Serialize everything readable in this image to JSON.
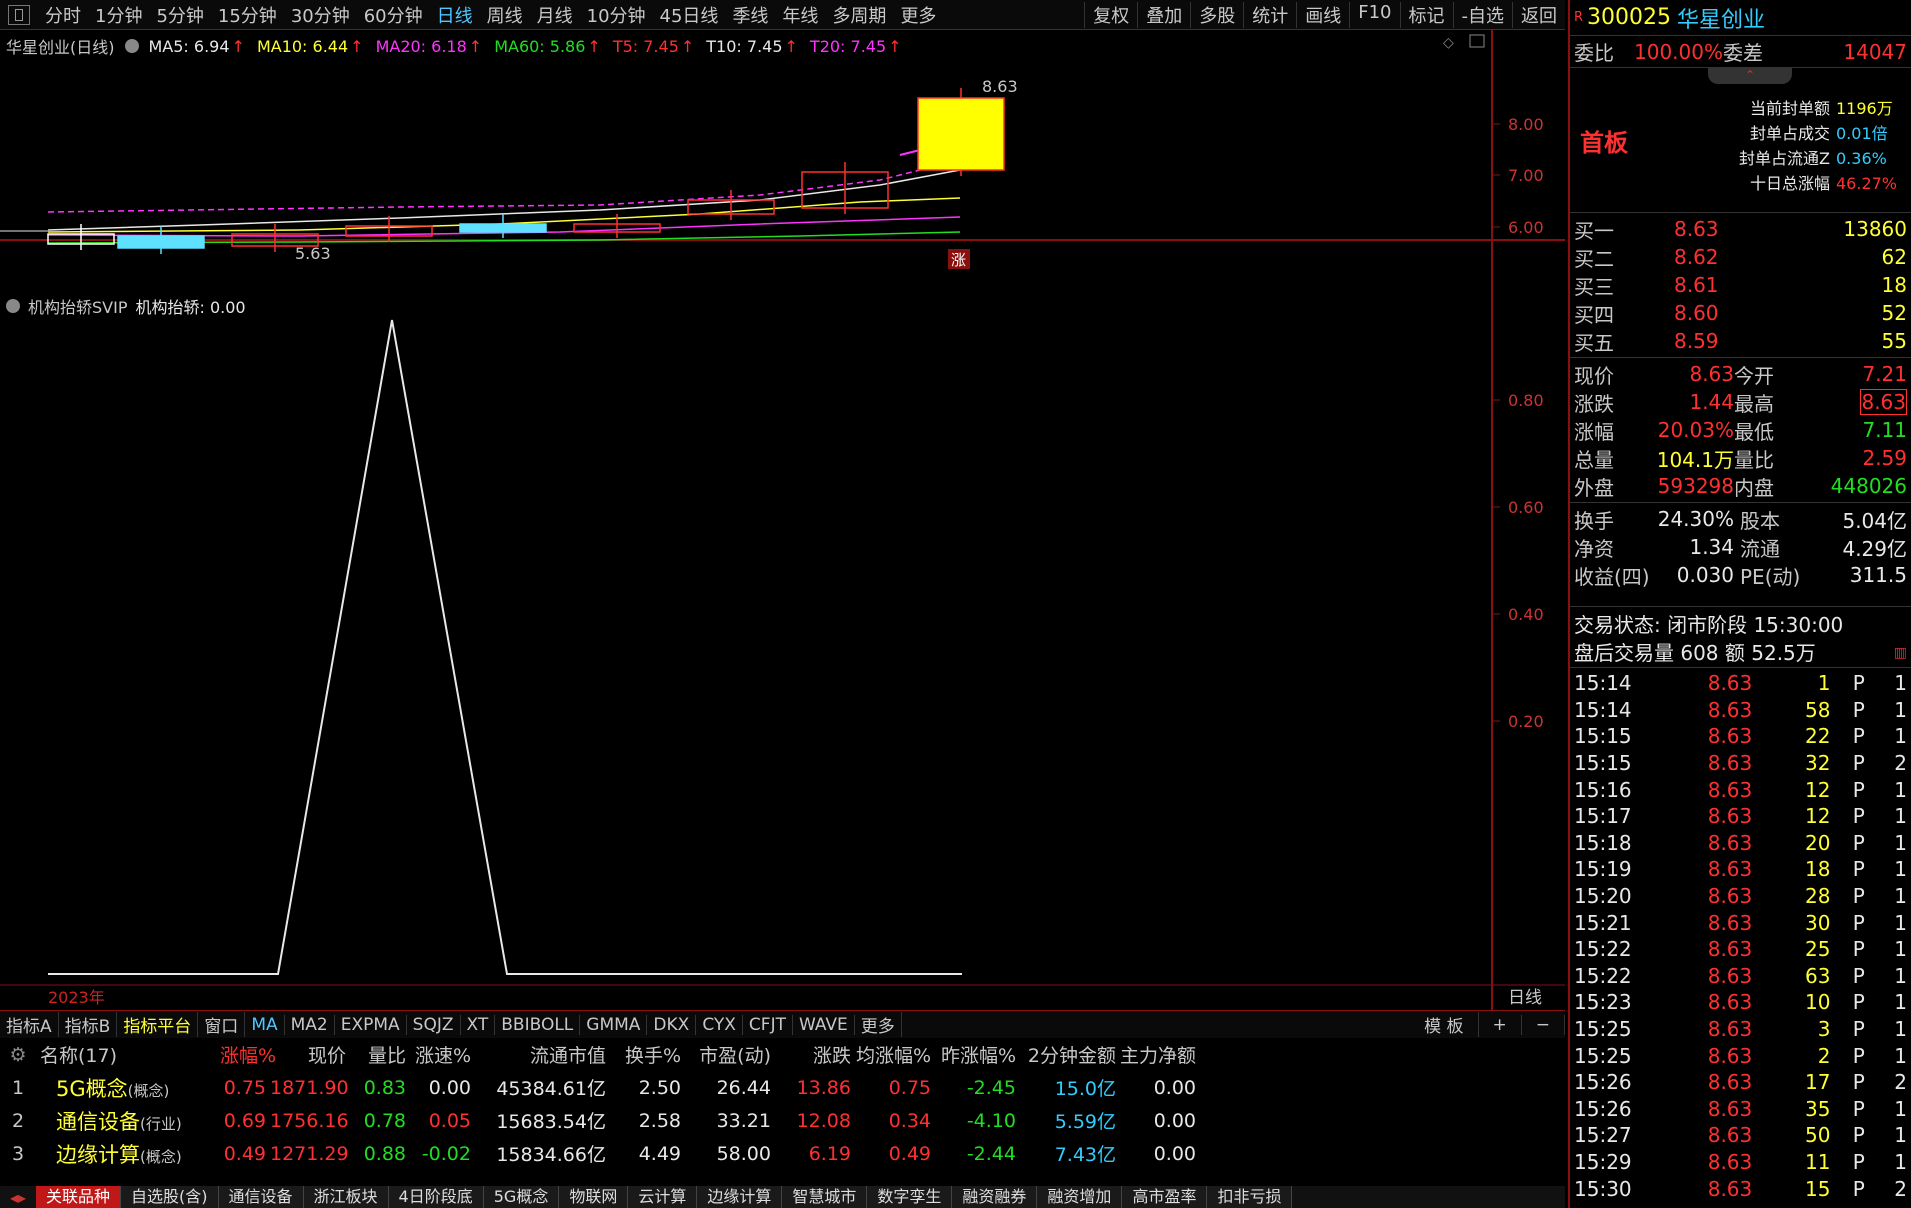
{
  "toolbar": {
    "periods": [
      "分时",
      "1分钟",
      "5分钟",
      "15分钟",
      "30分钟",
      "60分钟",
      "日线",
      "周线",
      "月线",
      "10分钟",
      "45日线",
      "季线",
      "年线",
      "多周期",
      "更多"
    ],
    "active_period": "日线",
    "right_buttons": [
      "复权",
      "叠加",
      "多股",
      "统计",
      "画线",
      "F10",
      "标记",
      "-自选",
      "返回"
    ]
  },
  "kline": {
    "title": "华星创业(日线)",
    "ma_items": [
      {
        "label": "MA5: 6.94",
        "color": "#e8e8e8"
      },
      {
        "label": "MA10: 6.44",
        "color": "#ffff33"
      },
      {
        "label": "MA20: 6.18",
        "color": "#ff33ff"
      },
      {
        "label": "MA60: 5.86",
        "color": "#22dd22"
      },
      {
        "label": "T5: 7.45",
        "color": "#ff3030"
      },
      {
        "label": "T10: 7.45",
        "color": "#e8e8e8"
      },
      {
        "label": "T20: 7.45",
        "color": "#ff33ff"
      }
    ],
    "high_label": "8.63",
    "low_label": "5.63",
    "limit_tag": "涨",
    "y_ticks": [
      "8.00",
      "7.00",
      "6.00"
    ]
  },
  "indicator": {
    "title": "机构抬轿SVIP",
    "value_label": "机构抬轿: 0.00",
    "y_ticks": [
      "0.80",
      "0.60",
      "0.40",
      "0.20"
    ],
    "year_label": "2023年",
    "period_label": "日线"
  },
  "indicator_tabs": [
    "指标A",
    "指标B",
    "指标平台",
    "窗口",
    "MA",
    "MA2",
    "EXPMA",
    "SQJZ",
    "XT",
    "BBIBOLL",
    "GMMA",
    "DKX",
    "CYX",
    "CFJT",
    "WAVE",
    "更多"
  ],
  "indicator_tabs_right": [
    "模 板",
    "+",
    "−"
  ],
  "table": {
    "headers": [
      "名称(17)",
      "涨幅%",
      "现价",
      "量比",
      "涨速%",
      "流通市值",
      "换手%",
      "市盈(动)",
      "涨跌",
      "均涨幅%",
      "昨涨幅%",
      "2分钟金额",
      "主力净额"
    ],
    "rows": [
      {
        "idx": "1",
        "name": "5G概念",
        "tag": "(概念)",
        "chg": "0.75",
        "price": "1871.90",
        "vr": "0.83",
        "spd": "0.00",
        "mcap": "45384.61亿",
        "turn": "2.50",
        "pe": "26.44",
        "diff": "13.86",
        "avg": "0.75",
        "ychg": "-2.45",
        "amt2": "15.0亿",
        "net": "0.00"
      },
      {
        "idx": "2",
        "name": "通信设备",
        "tag": "(行业)",
        "chg": "0.69",
        "price": "1756.16",
        "vr": "0.78",
        "spd": "0.05",
        "mcap": "15683.54亿",
        "turn": "2.58",
        "pe": "33.21",
        "diff": "12.08",
        "avg": "0.34",
        "ychg": "-4.10",
        "amt2": "5.59亿",
        "net": "0.00"
      },
      {
        "idx": "3",
        "name": "边缘计算",
        "tag": "(概念)",
        "chg": "0.49",
        "price": "1271.29",
        "vr": "0.88",
        "spd": "-0.02",
        "mcap": "15834.66亿",
        "turn": "4.49",
        "pe": "58.00",
        "diff": "6.19",
        "avg": "0.49",
        "ychg": "-2.44",
        "amt2": "7.43亿",
        "net": "0.00"
      }
    ]
  },
  "sheets": [
    "关联品种",
    "自选股(含)",
    "通信设备",
    "浙江板块",
    "4日阶段底",
    "5G概念",
    "物联网",
    "云计算",
    "边缘计算",
    "智慧城市",
    "数字孪生",
    "融资融券",
    "融资增加",
    "高市盈率",
    "扣非亏损"
  ],
  "active_sheet": "关联品种",
  "quote": {
    "code": "300025",
    "name": "华星创业",
    "wb_label": "委比",
    "wb_value": "100.00%",
    "wc_label": "委差",
    "wc_value": "14047",
    "board": "首板",
    "seal_items": [
      {
        "label": "当前封单额",
        "value": "1196万"
      },
      {
        "label": "封单占成交",
        "value": "0.01倍"
      },
      {
        "label": "封单占流通Z",
        "value": "0.36%"
      },
      {
        "label": "十日总涨幅",
        "value": "46.27%"
      }
    ],
    "bids": [
      {
        "label": "买一",
        "price": "8.63",
        "vol": "13860"
      },
      {
        "label": "买二",
        "price": "8.62",
        "vol": "62"
      },
      {
        "label": "买三",
        "price": "8.61",
        "vol": "18"
      },
      {
        "label": "买四",
        "price": "8.60",
        "vol": "52"
      },
      {
        "label": "买五",
        "price": "8.59",
        "vol": "55"
      }
    ],
    "stats": [
      {
        "l1": "现价",
        "v1": "8.63",
        "c1": "red",
        "l2": "今开",
        "v2": "7.21",
        "c2": "red"
      },
      {
        "l1": "涨跌",
        "v1": "1.44",
        "c1": "red",
        "l2": "最高",
        "v2": "8.63",
        "c2": "red"
      },
      {
        "l1": "涨幅",
        "v1": "20.03%",
        "c1": "red",
        "l2": "最低",
        "v2": "7.11",
        "c2": "green"
      },
      {
        "l1": "总量",
        "v1": "104.1万",
        "c1": "yellow",
        "l2": "量比",
        "v2": "2.59",
        "c2": "red"
      },
      {
        "l1": "外盘",
        "v1": "593298",
        "c1": "red",
        "l2": "内盘",
        "v2": "448026",
        "c2": "green"
      }
    ],
    "stats2": [
      {
        "l1": "换手",
        "v1": "24.30%",
        "l2": "股本",
        "v2": "5.04亿"
      },
      {
        "l1": "净资",
        "v1": "1.34",
        "l2": "流通",
        "v2": "4.29亿"
      },
      {
        "l1": "收益(四)",
        "v1": "0.030",
        "l2": "PE(动)",
        "v2": "311.5"
      }
    ],
    "trade_status": "交易状态: 闭市阶段 15:30:00",
    "after_hours": "盘后交易量 608 额 52.5万",
    "ticks": [
      {
        "t": "15:14",
        "p": "8.63",
        "v": "1",
        "f": "P",
        "n": "1"
      },
      {
        "t": "15:14",
        "p": "8.63",
        "v": "58",
        "f": "P",
        "n": "1"
      },
      {
        "t": "15:15",
        "p": "8.63",
        "v": "22",
        "f": "P",
        "n": "1"
      },
      {
        "t": "15:15",
        "p": "8.63",
        "v": "32",
        "f": "P",
        "n": "2"
      },
      {
        "t": "15:16",
        "p": "8.63",
        "v": "12",
        "f": "P",
        "n": "1"
      },
      {
        "t": "15:17",
        "p": "8.63",
        "v": "12",
        "f": "P",
        "n": "1"
      },
      {
        "t": "15:18",
        "p": "8.63",
        "v": "20",
        "f": "P",
        "n": "1"
      },
      {
        "t": "15:19",
        "p": "8.63",
        "v": "18",
        "f": "P",
        "n": "1"
      },
      {
        "t": "15:20",
        "p": "8.63",
        "v": "28",
        "f": "P",
        "n": "1"
      },
      {
        "t": "15:21",
        "p": "8.63",
        "v": "30",
        "f": "P",
        "n": "1"
      },
      {
        "t": "15:22",
        "p": "8.63",
        "v": "25",
        "f": "P",
        "n": "1"
      },
      {
        "t": "15:22",
        "p": "8.63",
        "v": "63",
        "f": "P",
        "n": "1"
      },
      {
        "t": "15:23",
        "p": "8.63",
        "v": "10",
        "f": "P",
        "n": "1"
      },
      {
        "t": "15:25",
        "p": "8.63",
        "v": "3",
        "f": "P",
        "n": "1"
      },
      {
        "t": "15:25",
        "p": "8.63",
        "v": "2",
        "f": "P",
        "n": "1"
      },
      {
        "t": "15:26",
        "p": "8.63",
        "v": "17",
        "f": "P",
        "n": "2"
      },
      {
        "t": "15:26",
        "p": "8.63",
        "v": "35",
        "f": "P",
        "n": "1"
      },
      {
        "t": "15:27",
        "p": "8.63",
        "v": "50",
        "f": "P",
        "n": "1"
      },
      {
        "t": "15:29",
        "p": "8.63",
        "v": "11",
        "f": "P",
        "n": "1"
      },
      {
        "t": "15:30",
        "p": "8.63",
        "v": "15",
        "f": "P",
        "n": "2"
      }
    ]
  }
}
